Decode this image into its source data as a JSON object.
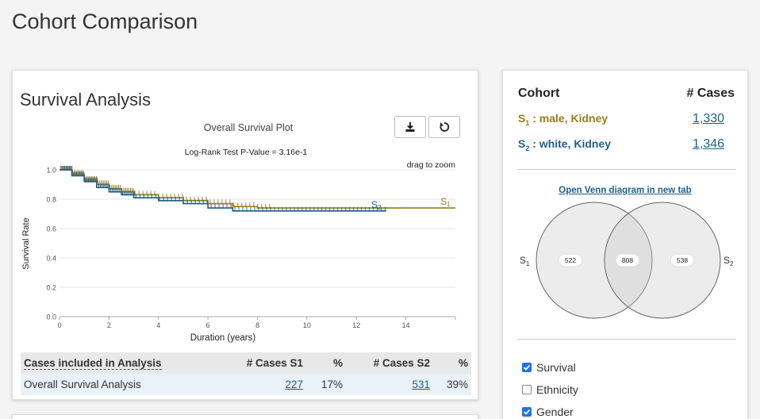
{
  "page": {
    "title": "Cohort Comparison"
  },
  "survival": {
    "title": "Survival Analysis",
    "plot_title": "Overall Survival Plot",
    "pvalue": "Log-Rank Test P-Value = 3.16e-1",
    "drag_hint": "drag to zoom",
    "buttons": {
      "download_icon": "download-icon",
      "reset_icon": "reset-icon"
    },
    "table": {
      "headers": [
        "Cases included in Analysis",
        "# Cases S1",
        "%",
        "# Cases S2",
        "%"
      ],
      "rows": [
        {
          "label": "Overall Survival Analysis",
          "cases_s1": "227",
          "pct_s1": "17%",
          "cases_s2": "531",
          "pct_s2": "39%"
        }
      ]
    }
  },
  "chart_data": {
    "type": "line",
    "title": "Overall Survival Plot",
    "subtitle": "Log-Rank Test P-Value = 3.16e-1",
    "xlabel": "Duration (years)",
    "ylabel": "Survival Rate",
    "xlim": [
      0,
      16
    ],
    "ylim": [
      0,
      1
    ],
    "xticks": [
      0,
      2,
      4,
      6,
      8,
      10,
      12,
      14
    ],
    "yticks": [
      "0.0",
      "0.2",
      "0.4",
      "0.6",
      "0.8",
      "1.0"
    ],
    "grid": true,
    "series": [
      {
        "name": "S1",
        "color": "#9a7b1c",
        "x": [
          0,
          0.5,
          1,
          1.5,
          2,
          2.5,
          3,
          4,
          5,
          6,
          7,
          8,
          10,
          12,
          16
        ],
        "y": [
          1.0,
          0.97,
          0.93,
          0.9,
          0.87,
          0.85,
          0.83,
          0.81,
          0.79,
          0.77,
          0.75,
          0.74,
          0.74,
          0.74,
          0.74
        ]
      },
      {
        "name": "S2",
        "color": "#1f5f8b",
        "x": [
          0,
          0.5,
          1,
          1.5,
          2,
          2.5,
          3,
          4,
          5,
          6,
          7,
          8,
          10,
          12,
          13.2
        ],
        "y": [
          1.0,
          0.96,
          0.92,
          0.88,
          0.85,
          0.83,
          0.81,
          0.79,
          0.77,
          0.74,
          0.72,
          0.72,
          0.72,
          0.72,
          0.72
        ]
      }
    ]
  },
  "cohort": {
    "header_label": "Cohort",
    "header_cases": "# Cases",
    "s1_label": ": male, Kidney",
    "s1_count": "1,330",
    "s2_label": ": white, Kidney",
    "s2_count": "1,346",
    "venn_link": "Open Venn diagram in new tab",
    "venn": {
      "s1_only": "522",
      "both": "808",
      "s2_only": "538"
    },
    "s1_color": "#9a7b1c",
    "s2_color": "#1f5f8b"
  },
  "facets": [
    {
      "label": "Survival",
      "checked": true
    },
    {
      "label": "Ethnicity",
      "checked": false
    },
    {
      "label": "Gender",
      "checked": true
    }
  ]
}
